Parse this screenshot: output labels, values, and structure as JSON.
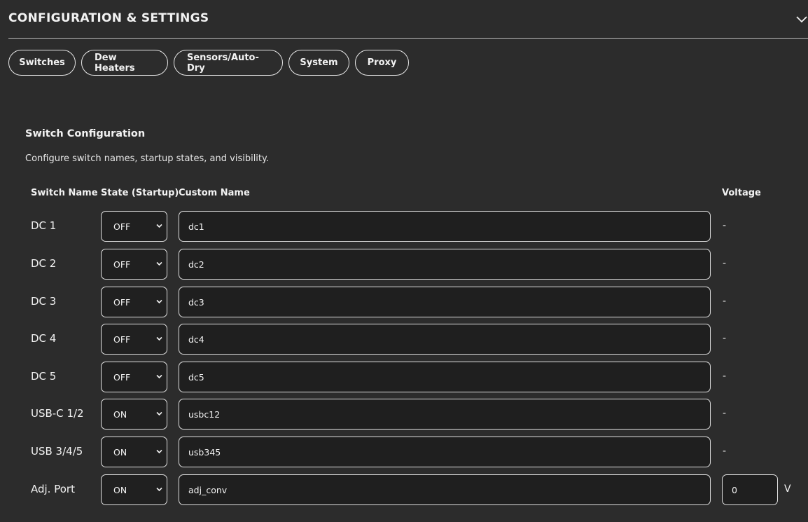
{
  "header": {
    "title": "CONFIGURATION & SETTINGS",
    "toggle_icon": "chevron-down-icon"
  },
  "tabs": [
    "Switches",
    "Dew Heaters",
    "Sensors/Auto-Dry",
    "System",
    "Proxy"
  ],
  "section": {
    "title": "Switch Configuration",
    "description": "Configure switch names, startup states, and visibility."
  },
  "columns": {
    "switch_name": "Switch Name",
    "state": "State (Startup)",
    "custom_name": "Custom Name",
    "voltage": "Voltage"
  },
  "rows": [
    {
      "label": "DC 1",
      "state": "OFF",
      "custom_name": "dc1",
      "voltage": "-"
    },
    {
      "label": "DC 2",
      "state": "OFF",
      "custom_name": "dc2",
      "voltage": "-"
    },
    {
      "label": "DC 3",
      "state": "OFF",
      "custom_name": "dc3",
      "voltage": "-"
    },
    {
      "label": "DC 4",
      "state": "OFF",
      "custom_name": "dc4",
      "voltage": "-"
    },
    {
      "label": "DC 5",
      "state": "OFF",
      "custom_name": "dc5",
      "voltage": "-"
    },
    {
      "label": "USB-C 1/2",
      "state": "ON",
      "custom_name": "usbc12",
      "voltage": "-"
    },
    {
      "label": "USB 3/4/5",
      "state": "ON",
      "custom_name": "usb345",
      "voltage": "-"
    },
    {
      "label": "Adj. Port",
      "state": "ON",
      "custom_name": "adj_conv",
      "voltage_input": "0",
      "voltage_unit": "V"
    }
  ]
}
